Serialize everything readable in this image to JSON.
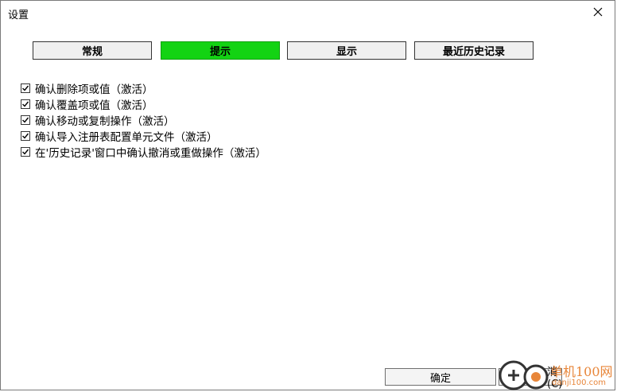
{
  "window": {
    "title": "设置"
  },
  "tabs": [
    {
      "label": "常规",
      "active": false
    },
    {
      "label": "提示",
      "active": true
    },
    {
      "label": "显示",
      "active": false
    },
    {
      "label": "最近历史记录",
      "active": false
    }
  ],
  "options": [
    {
      "label": "确认删除项或值（激活）",
      "checked": true
    },
    {
      "label": "确认覆盖项或值（激活）",
      "checked": true
    },
    {
      "label": "确认移动或复制操作（激活）",
      "checked": true
    },
    {
      "label": "确认导入注册表配置单元文件（激活）",
      "checked": true
    },
    {
      "label": "在'历史记录'窗口中确认撤消或重做操作（激活）",
      "checked": true
    }
  ],
  "buttons": {
    "ok": "确定",
    "cancel": "消(C)"
  },
  "watermark": {
    "name": "单机100网",
    "url": "danji100.com"
  },
  "colors": {
    "active_tab": "#13d313",
    "watermark": "#e8863a"
  }
}
